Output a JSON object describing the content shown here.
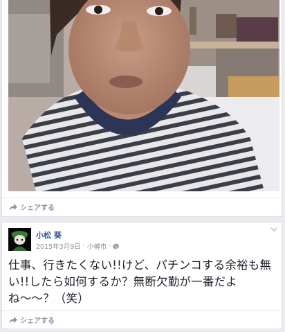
{
  "post1": {
    "share_label": "シェアする",
    "share_icon": "share-arrow-icon"
  },
  "post2": {
    "author": "小松 葵",
    "date": "2015年3月9日",
    "separator": "·",
    "location": "小樽市",
    "privacy_icon": "globe-icon",
    "menu_icon": "chevron-down-icon",
    "text": "仕事、行きたくない!!けど、パチンコする余裕も無い!!したら如何するか？無断欠勤が一番だよね〜〜？（笑）",
    "share_label": "シェアする",
    "share_icon": "share-arrow-icon"
  },
  "colors": {
    "page_bg": "#e9ebee",
    "card_bg": "#ffffff",
    "link": "#365899",
    "muted": "#90949c"
  }
}
